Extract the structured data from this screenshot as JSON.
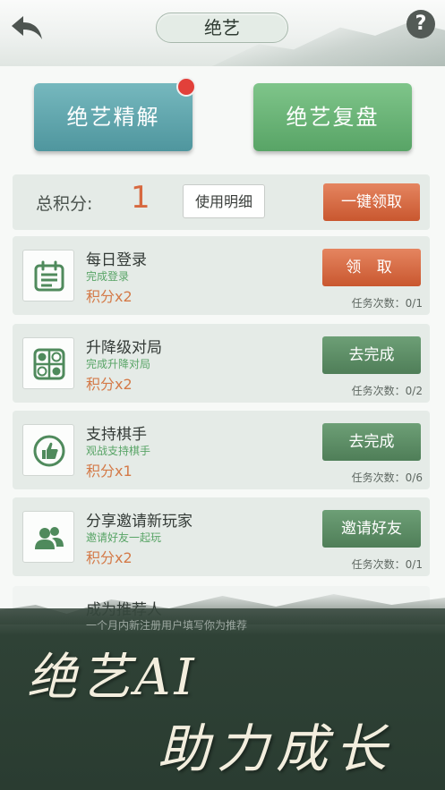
{
  "header": {
    "title": "绝艺",
    "back_icon": "back-arrow-icon",
    "help_label": "?"
  },
  "actions": {
    "analysis_label": "绝艺精解",
    "review_label": "绝艺复盘"
  },
  "score": {
    "label": "总积分:",
    "value": "1",
    "detail_label": "使用明细",
    "claim_all_label": "一键领取"
  },
  "tasks": [
    {
      "title": "每日登录",
      "subtitle": "完成登录",
      "points": "积分x2",
      "button": "领 取",
      "count": "任务次数：0/1",
      "icon": "calendar-icon"
    },
    {
      "title": "升降级对局",
      "subtitle": "完成升降对局",
      "points": "积分x2",
      "button": "去完成",
      "count": "任务次数：0/2",
      "icon": "go-board-icon"
    },
    {
      "title": "支持棋手",
      "subtitle": "观战支持棋手",
      "points": "积分x1",
      "button": "去完成",
      "count": "任务次数：0/6",
      "icon": "thumbs-up-icon"
    },
    {
      "title": "分享邀请新玩家",
      "subtitle": "邀请好友一起玩",
      "points": "积分x2",
      "button": "邀请好友",
      "count": "任务次数：0/1",
      "icon": "users-icon"
    },
    {
      "title": "成为推荐人",
      "subtitle": "一个月内新注册用户填写你为推荐"
    }
  ],
  "banner": {
    "line1": "绝艺AI",
    "line2": "助力成长"
  },
  "colors": {
    "accent_orange": "#d7683f",
    "accent_green": "#58a466",
    "notification_red": "#e2403a"
  }
}
